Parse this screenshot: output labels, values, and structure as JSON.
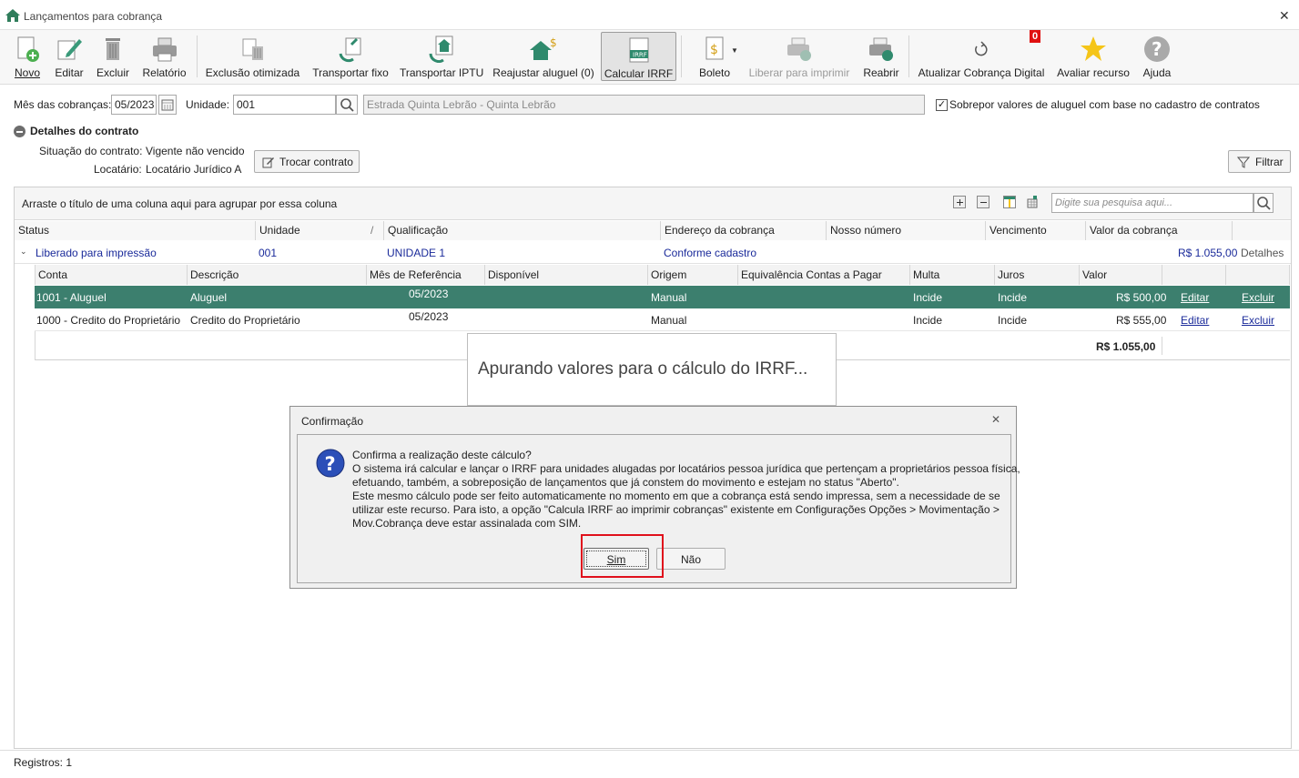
{
  "window": {
    "title": "Lançamentos para cobrança",
    "close": "✕"
  },
  "toolbar": {
    "novo": "Novo",
    "editar": "Editar",
    "excluir": "Excluir",
    "relatorio": "Relatório",
    "exclusao_otimizada": "Exclusão otimizada",
    "transportar_fixo": "Transportar fixo",
    "transportar_iptu": "Transportar IPTU",
    "reajustar_aluguel": "Reajustar aluguel (0)",
    "calcular_irrf": "Calcular IRRF",
    "calcular_irrf_icon_text": "IRRF",
    "boleto": "Boleto",
    "liberar_para_imprimir": "Liberar para imprimir",
    "reabrir": "Reabrir",
    "atualizar_cobranca_digital": "Atualizar Cobrança Digital",
    "atualizar_badge": "0",
    "avaliar_recurso": "Avaliar recurso",
    "ajuda": "Ajuda"
  },
  "filters": {
    "mes_label": "Mês das cobranças:",
    "mes_value": "05/2023",
    "unidade_label": "Unidade:",
    "unidade_value": "001",
    "unidade_desc": "Estrada Quinta Lebrão - Quinta Lebrão",
    "sobrepor_label": "Sobrepor valores de aluguel com base no cadastro de contratos",
    "sobrepor_checked": "✓"
  },
  "details": {
    "header": "Detalhes do contrato",
    "situacao_label": "Situação do contrato:",
    "situacao_value": "Vigente não vencido",
    "locatario_label": "Locatário:",
    "locatario_value": "Locatário Jurídico A",
    "trocar_button": "Trocar contrato",
    "filtrar_button": "Filtrar"
  },
  "grid": {
    "group_hint": "Arraste o título de uma coluna aqui para agrupar por essa coluna",
    "search_placeholder": "Digite sua pesquisa aqui...",
    "columns": [
      "Status",
      "Unidade",
      "Qualificação",
      "Endereço da cobrança",
      "Nosso número",
      "Vencimento",
      "Valor da cobrança"
    ],
    "group_row": {
      "status": "Liberado para impressão",
      "unidade": "001",
      "qualificacao": "UNIDADE 1",
      "endereco": "Conforme cadastro",
      "valor": "R$ 1.055,00",
      "detalhes": "Detalhes"
    },
    "sub_columns": [
      "Conta",
      "Descrição",
      "Mês de Referência",
      "Disponível",
      "Origem",
      "Equivalência Contas a Pagar",
      "Multa",
      "Juros",
      "Valor"
    ],
    "rows": [
      {
        "conta": "1001 - Aluguel",
        "descricao": "Aluguel",
        "mes": "05/2023",
        "origem": "Manual",
        "multa": "Incide",
        "juros": "Incide",
        "valor": "R$ 500,00",
        "editar": "Editar",
        "excluir": "Excluir"
      },
      {
        "conta": "1000 - Credito do Proprietário",
        "descricao": "Credito do Proprietário",
        "mes": "05/2023",
        "origem": "Manual",
        "multa": "Incide",
        "juros": "Incide",
        "valor": "R$ 555,00",
        "editar": "Editar",
        "excluir": "Excluir"
      }
    ],
    "total": "R$ 1.055,00"
  },
  "progress": {
    "text": "Apurando valores para o cálculo do IRRF..."
  },
  "dialog": {
    "title": "Confirmação",
    "close": "✕",
    "lines": [
      "Confirma a realização deste cálculo?",
      "O sistema irá calcular e lançar o IRRF para unidades alugadas por locatários pessoa jurídica que pertençam a proprietários pessoa física,",
      "efetuando, também, a sobreposição de lançamentos que já constem do movimento e estejam no status \"Aberto\".",
      "Este mesmo cálculo pode ser feito automaticamente no momento em que a cobrança está sendo impressa, sem a necessidade de se",
      "utilizar este recurso. Para isto, a opção \"Calcula IRRF ao imprimir cobranças\" existente em Configurações Opções > Movimentação >",
      "Mov.Cobrança deve estar assinalada com SIM."
    ],
    "sim": "Sim",
    "nao": "Não"
  },
  "footer": {
    "registros": "Registros: 1"
  },
  "colors": {
    "selected_row": "#3c7f6e",
    "link": "#1a2a9a",
    "highlight": "#e0101c"
  }
}
